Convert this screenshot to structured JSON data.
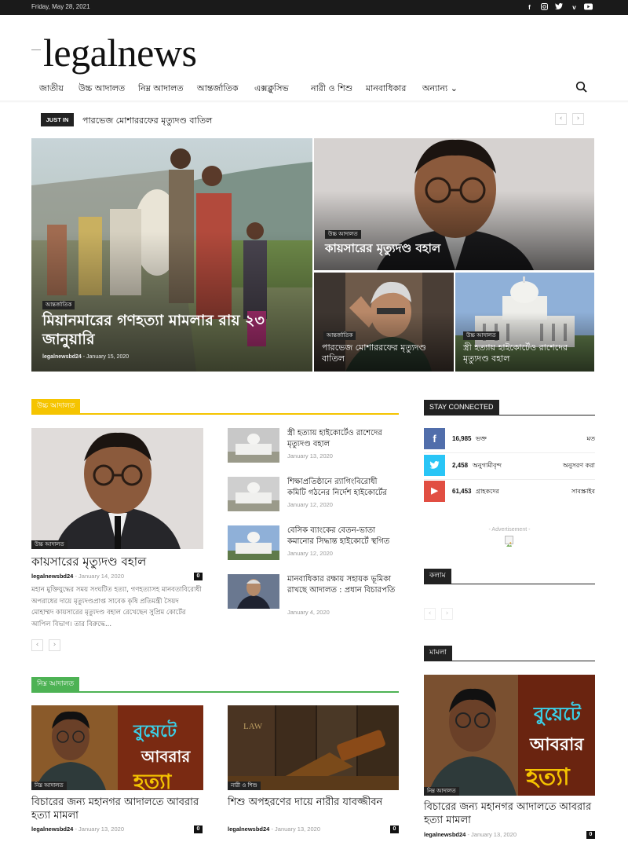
{
  "topbar": {
    "date": "Friday, May 28, 2021",
    "social": [
      "f",
      "ig",
      "tw",
      "v",
      "yt"
    ]
  },
  "logo": {
    "text": "legalnews"
  },
  "nav": {
    "items": [
      "জাতীয়",
      "উচ্চ আদালত",
      "নিম্ন আদালত",
      "আন্তর্জাতিক",
      "এক্সক্লুসিভ",
      "নারী ও শিশু",
      "মানবাধিকার",
      "অন্যান্য ⌄"
    ]
  },
  "justin": {
    "tag": "JUST IN",
    "headline": "পারভেজ মোশাররফের মৃত্যুদণ্ড বাতিল"
  },
  "hero": {
    "main": {
      "category": "আন্তর্জাতিক",
      "title": "মিয়ানমারের গণহত্যা মামলার রায় ২৩ জানুয়ারি",
      "author": "legalnewsbd24",
      "date": "January 15, 2020"
    },
    "top_right": {
      "category": "উচ্চ আদালত",
      "title": "কায়সারের মৃত্যুদণ্ড বহাল"
    },
    "bottom_left": {
      "category": "আন্তর্জাতিক",
      "title": "পারভেজ মোশাররফের মৃত্যুদণ্ড বাতিল"
    },
    "bottom_right": {
      "category": "উচ্চ আদালত",
      "title": "স্ত্রী হত্যায় হাইকোর্টেও রাশেদের মৃত্যুদণ্ড বহাল"
    }
  },
  "high_court": {
    "heading": "উচ্চ আদালত",
    "featured": {
      "category": "উচ্চ আদালত",
      "title": "কায়সারের মৃত্যুদণ্ড বহাল",
      "author": "legalnewsbd24",
      "date": "January 14, 2020",
      "comments": "0",
      "excerpt": "মহান মুক্তিযুদ্ধের সময় সংঘটিত হত্যা, গণহত্যাসহ মানবতাবিরোধী অপরাধের দায়ে মৃত্যুদণ্ডপ্রাপ্ত সাবেক কৃষি প্রতিমন্ত্রী সৈয়দ মোহাম্মদ কায়সারের মৃত্যুদণ্ড বহাল রেখেছেন সুপ্রিম কোর্টের আপিল বিভাগ। তার বিরুদ্ধে..."
    },
    "list": [
      {
        "title": "স্ত্রী হত্যায় হাইকোর্টেও রাশেদের মৃত্যুদণ্ড বহাল",
        "date": "January 13, 2020"
      },
      {
        "title": "শিক্ষাপ্রতিষ্ঠানে র‍্যাগিংবিরোধী কমিটি গঠনের নির্দেশ হাইকোর্টের",
        "date": "January 12, 2020"
      },
      {
        "title": "বেসিক ব্যাংকের বেতন-ভাতা কমানোর সিদ্ধান্ত হাইকোর্টে স্থগিত",
        "date": "January 12, 2020"
      },
      {
        "title": "মানবাধিকার রক্ষায় সহায়ক ভূমিকা রাখছে আদালত : প্রধান বিচারপতি",
        "date": "January 4, 2020"
      }
    ]
  },
  "lower_court": {
    "heading": "নিম্ন আদালত",
    "posts": [
      {
        "category": "নিম্ন আদালত",
        "title": "বিচারের জন্য মহানগর আদালতে আবরার হত্যা মামলা",
        "author": "legalnewsbd24",
        "date": "January 13, 2020",
        "comments": "0",
        "img_text_1": "বুয়েটে",
        "img_text_2": "আবরার",
        "img_text_3": "হত্যা"
      },
      {
        "category": "নারী ও শিশু",
        "title": "শিশু অপহরণের দায়ে নারীর যাবজ্জীবন",
        "author": "legalnewsbd24",
        "date": "January 13, 2020",
        "comments": "0",
        "img_text_1": "LAW"
      }
    ]
  },
  "stay_connected": {
    "heading": "STAY CONNECTED",
    "rows": [
      {
        "icon": "f",
        "count": "16,985",
        "label": "ভক্ত",
        "action": "মত",
        "color": "#516eab"
      },
      {
        "icon": "t",
        "count": "2,458",
        "label": "অনুগামীবৃন্দ",
        "action": "অনুসরণ করা",
        "color": "#29c5f6"
      },
      {
        "icon": "▶",
        "count": "61,453",
        "label": "গ্রাহকদের",
        "action": "সাবস্ক্রাইব",
        "color": "#e14e42"
      }
    ]
  },
  "advertisement": {
    "label": "- Advertisement -"
  },
  "kolam": {
    "heading": "কলাম"
  },
  "mamla": {
    "heading": "মামলা",
    "post": {
      "category": "নিম্ন আদালত",
      "title": "বিচারের জন্য মহানগর আদালতে আবরার হত্যা মামলা",
      "author": "legalnewsbd24",
      "date": "January 13, 2020",
      "comments": "0",
      "img_text_1": "বুয়েটে",
      "img_text_2": "আবরার",
      "img_text_3": "হত্যা"
    }
  },
  "colors": {
    "high_court_accent": "#f5c400",
    "lower_court_accent": "#4db254",
    "dark": "#222222"
  }
}
